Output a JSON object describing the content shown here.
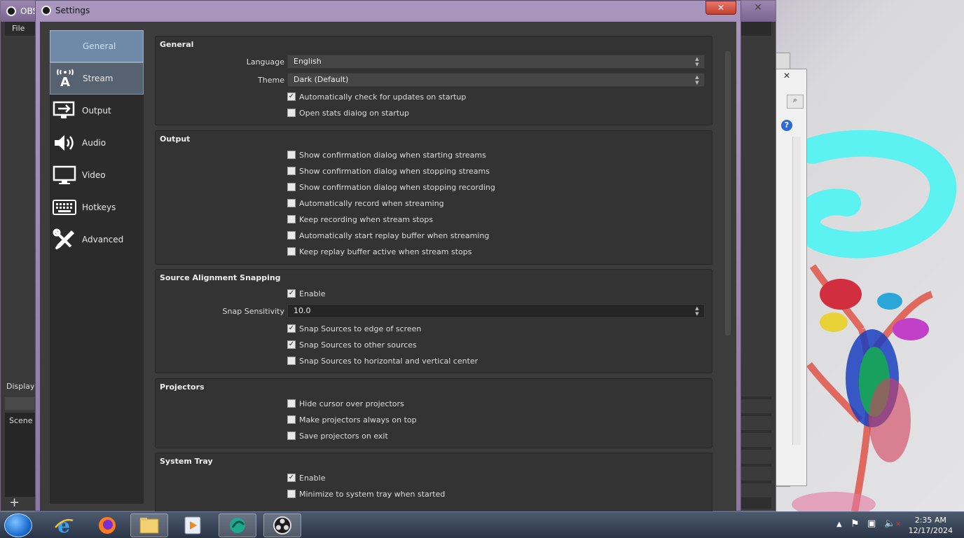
{
  "obs_main": {
    "title": "OBS",
    "menu_file": "File",
    "display_label": "Display",
    "scene_label": "Scene"
  },
  "settings": {
    "title": "Settings",
    "close_label": "✕",
    "nav": [
      {
        "label": "General",
        "icon": "gear-icon"
      },
      {
        "label": "Stream",
        "icon": "broadcast-antenna-icon"
      },
      {
        "label": "Output",
        "icon": "output-monitor-icon"
      },
      {
        "label": "Audio",
        "icon": "speaker-icon"
      },
      {
        "label": "Video",
        "icon": "monitor-icon"
      },
      {
        "label": "Hotkeys",
        "icon": "keyboard-icon"
      },
      {
        "label": "Advanced",
        "icon": "tools-icon"
      }
    ],
    "general": {
      "title": "General",
      "language_label": "Language",
      "language_value": "English",
      "theme_label": "Theme",
      "theme_value": "Dark (Default)",
      "auto_check_updates": {
        "label": "Automatically check for updates on startup",
        "checked": true
      },
      "open_stats": {
        "label": "Open stats dialog on startup",
        "checked": false
      }
    },
    "output": {
      "title": "Output",
      "options": [
        {
          "label": "Show confirmation dialog when starting streams",
          "checked": false
        },
        {
          "label": "Show confirmation dialog when stopping streams",
          "checked": false
        },
        {
          "label": "Show confirmation dialog when stopping recording",
          "checked": false
        },
        {
          "label": "Automatically record when streaming",
          "checked": false
        },
        {
          "label": "Keep recording when stream stops",
          "checked": false
        },
        {
          "label": "Automatically start replay buffer when streaming",
          "checked": false
        },
        {
          "label": "Keep replay buffer active when stream stops",
          "checked": false
        }
      ]
    },
    "snapping": {
      "title": "Source Alignment Snapping",
      "enable": {
        "label": "Enable",
        "checked": true
      },
      "sensitivity_label": "Snap Sensitivity",
      "sensitivity_value": "10.0",
      "options": [
        {
          "label": "Snap Sources to edge of screen",
          "checked": true
        },
        {
          "label": "Snap Sources to other sources",
          "checked": true
        },
        {
          "label": "Snap Sources to horizontal and vertical center",
          "checked": false
        }
      ]
    },
    "projectors": {
      "title": "Projectors",
      "options": [
        {
          "label": "Hide cursor over projectors",
          "checked": false
        },
        {
          "label": "Make projectors always on top",
          "checked": false
        },
        {
          "label": "Save projectors on exit",
          "checked": false
        }
      ]
    },
    "system_tray": {
      "title": "System Tray",
      "options": [
        {
          "label": "Enable",
          "checked": true
        },
        {
          "label": "Minimize to system tray when started",
          "checked": false
        }
      ]
    }
  },
  "taskbar": {
    "apps": [
      "internet-explorer-icon",
      "firefox-icon",
      "file-explorer-icon",
      "media-player-icon",
      "app-icon",
      "obs-icon"
    ],
    "time": "2:35 AM",
    "date": "12/17/2024"
  }
}
